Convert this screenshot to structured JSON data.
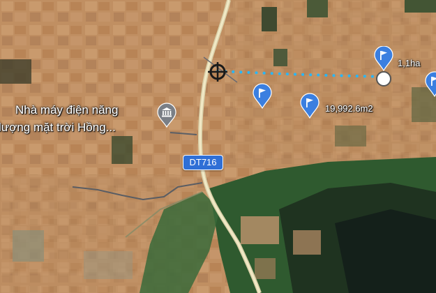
{
  "map": {
    "place_label": {
      "line1": "Nhà máy điện năng",
      "line2": "lượng mặt trời Hồng..."
    },
    "road_shield": "DT716",
    "area_pins": [
      {
        "label": "1,1ha"
      },
      {
        "label": "19,992.6m2"
      },
      {
        "label": ""
      }
    ],
    "colors": {
      "pin": "#3b7fe0",
      "measure_line": "#29b6f6",
      "road_shield": "#2f6fd6"
    },
    "icons": [
      "crosshair-icon",
      "flag-pin-icon",
      "poi-bank-icon"
    ]
  }
}
